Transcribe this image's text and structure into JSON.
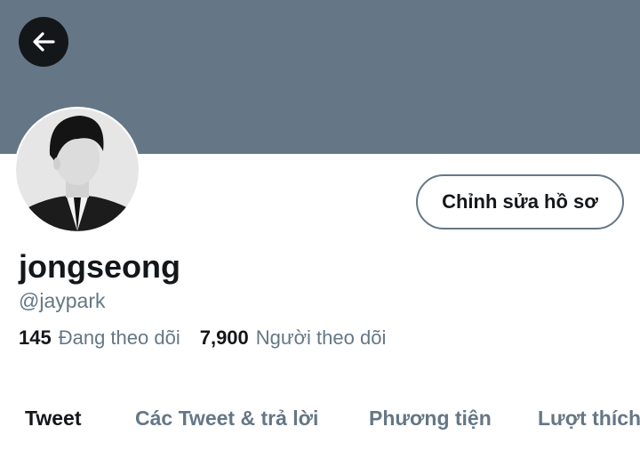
{
  "profile": {
    "display_name": "jongseong",
    "handle": "@jaypark",
    "edit_profile_label": "Chỉnh sửa hồ sơ"
  },
  "stats": {
    "following_count": "145",
    "following_label": "Đang theo dõi",
    "followers_count": "7,900",
    "followers_label": "Người theo dõi"
  },
  "tabs": [
    {
      "label": "Tweet",
      "active": true
    },
    {
      "label": "Các Tweet & trả lời",
      "active": false
    },
    {
      "label": "Phương tiện",
      "active": false
    },
    {
      "label": "Lượt thích",
      "active": false
    }
  ],
  "icons": {
    "back": "arrow-left-icon"
  },
  "colors": {
    "banner": "#657786",
    "text_primary": "#14171a",
    "text_secondary": "#657786",
    "back_button_bg": "#14171a"
  }
}
